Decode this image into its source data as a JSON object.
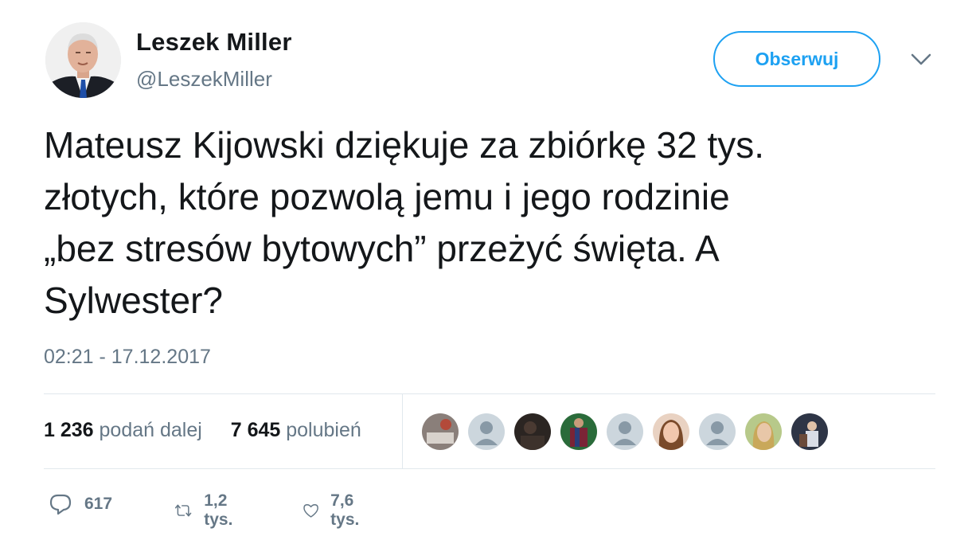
{
  "user": {
    "name": "Leszek Miller",
    "handle": "@LeszekMiller"
  },
  "follow_label": "Obserwuj",
  "tweet": {
    "lines": [
      "Mateusz Kijowski dziękuje za zbiórkę 32 tys.",
      "złotych, które pozwolą jemu i jego rodzinie",
      "„bez stresów bytowych” przeżyć święta. A",
      "Sylwester?"
    ],
    "timestamp": "02:21 - 17.12.2017"
  },
  "stats": {
    "retweets_count": "1 236",
    "retweets_label": "podań dalej",
    "likes_count": "7 645",
    "likes_label": "polubień"
  },
  "likers": [
    {
      "icon": "photo-avatar",
      "color": "#8a7f7a"
    },
    {
      "icon": "default-avatar",
      "color": "#ccd6dd"
    },
    {
      "icon": "photo-avatar",
      "color": "#2b2522"
    },
    {
      "icon": "photo-avatar",
      "color": "#3a4a6b"
    },
    {
      "icon": "default-avatar",
      "color": "#ccd6dd"
    },
    {
      "icon": "photo-avatar",
      "color": "#c99a7c"
    },
    {
      "icon": "default-avatar",
      "color": "#ccd6dd"
    },
    {
      "icon": "photo-avatar",
      "color": "#9aa86a"
    },
    {
      "icon": "photo-avatar",
      "color": "#3b4458"
    }
  ],
  "actions": {
    "reply_count": "617",
    "retweet_count": "1,2 tys.",
    "like_count": "7,6 tys."
  },
  "colors": {
    "accent": "#1da1f2",
    "text": "#14171a",
    "secondary": "#657786",
    "border": "#e1e8ed"
  }
}
